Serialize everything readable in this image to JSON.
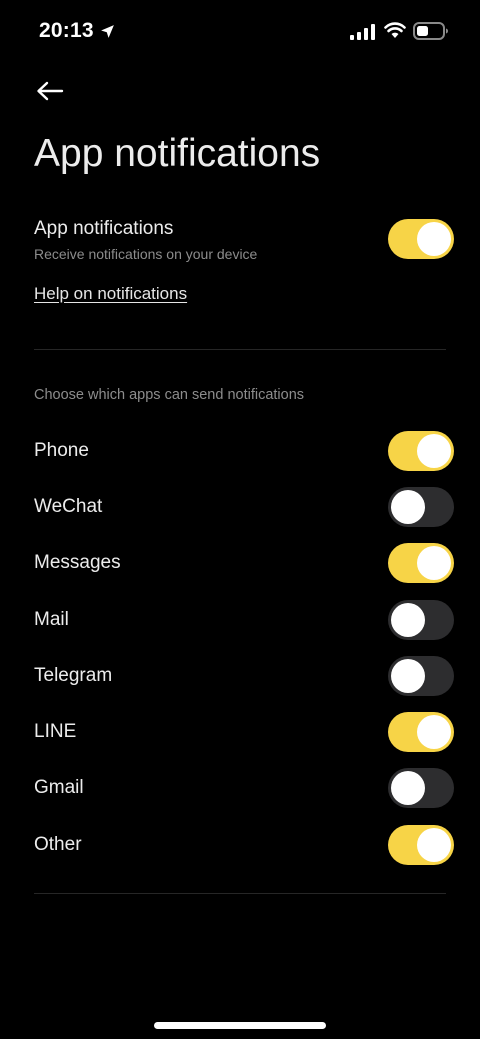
{
  "status_bar": {
    "time": "20:13",
    "icons": [
      "location-arrow-icon",
      "cellular-signal-icon",
      "wifi-icon",
      "battery-icon"
    ]
  },
  "header": {
    "back_icon": "back-arrow-icon",
    "title": "App notifications"
  },
  "master": {
    "title": "App notifications",
    "subtitle": "Receive notifications on your device",
    "enabled": true
  },
  "help_link": "Help on notifications",
  "section_label": "Choose which apps can send notifications",
  "apps": [
    {
      "label": "Phone",
      "enabled": true
    },
    {
      "label": "WeChat",
      "enabled": false
    },
    {
      "label": "Messages",
      "enabled": true
    },
    {
      "label": "Mail",
      "enabled": false
    },
    {
      "label": "Telegram",
      "enabled": false
    },
    {
      "label": "LINE",
      "enabled": true
    },
    {
      "label": "Gmail",
      "enabled": false
    },
    {
      "label": "Other",
      "enabled": true
    }
  ],
  "colors": {
    "background": "#000000",
    "toggle_on": "#f7d447",
    "toggle_off": "#2d2d2f",
    "knob": "#ffffff"
  }
}
